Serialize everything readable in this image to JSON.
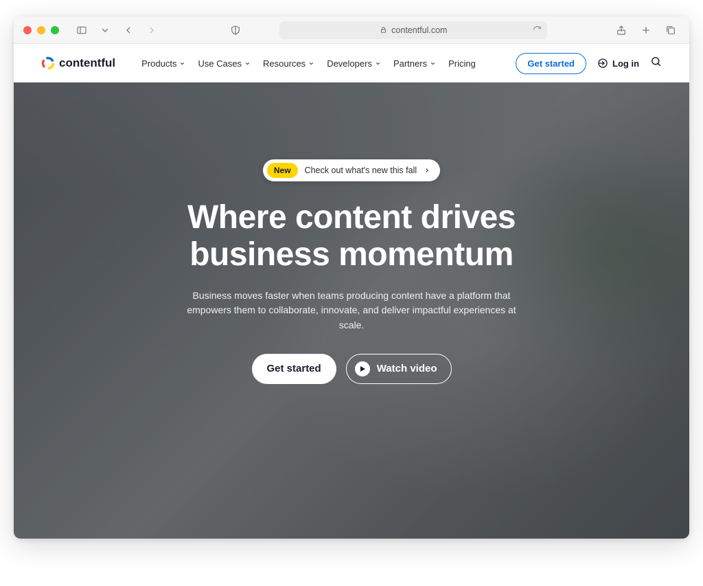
{
  "browser": {
    "url": "contentful.com"
  },
  "header": {
    "brand": "contentful",
    "nav": {
      "products": "Products",
      "use_cases": "Use Cases",
      "resources": "Resources",
      "developers": "Developers",
      "partners": "Partners",
      "pricing": "Pricing"
    },
    "cta": "Get started",
    "login": "Log in"
  },
  "hero": {
    "badge": "New",
    "badge_text": "Check out what's new this fall",
    "title_line1": "Where content drives",
    "title_line2": "business momentum",
    "subtitle": "Business moves faster when teams producing content have a platform that empowers them to collaborate, innovate, and deliver impactful experiences at scale.",
    "primary_cta": "Get started",
    "secondary_cta": "Watch video"
  }
}
